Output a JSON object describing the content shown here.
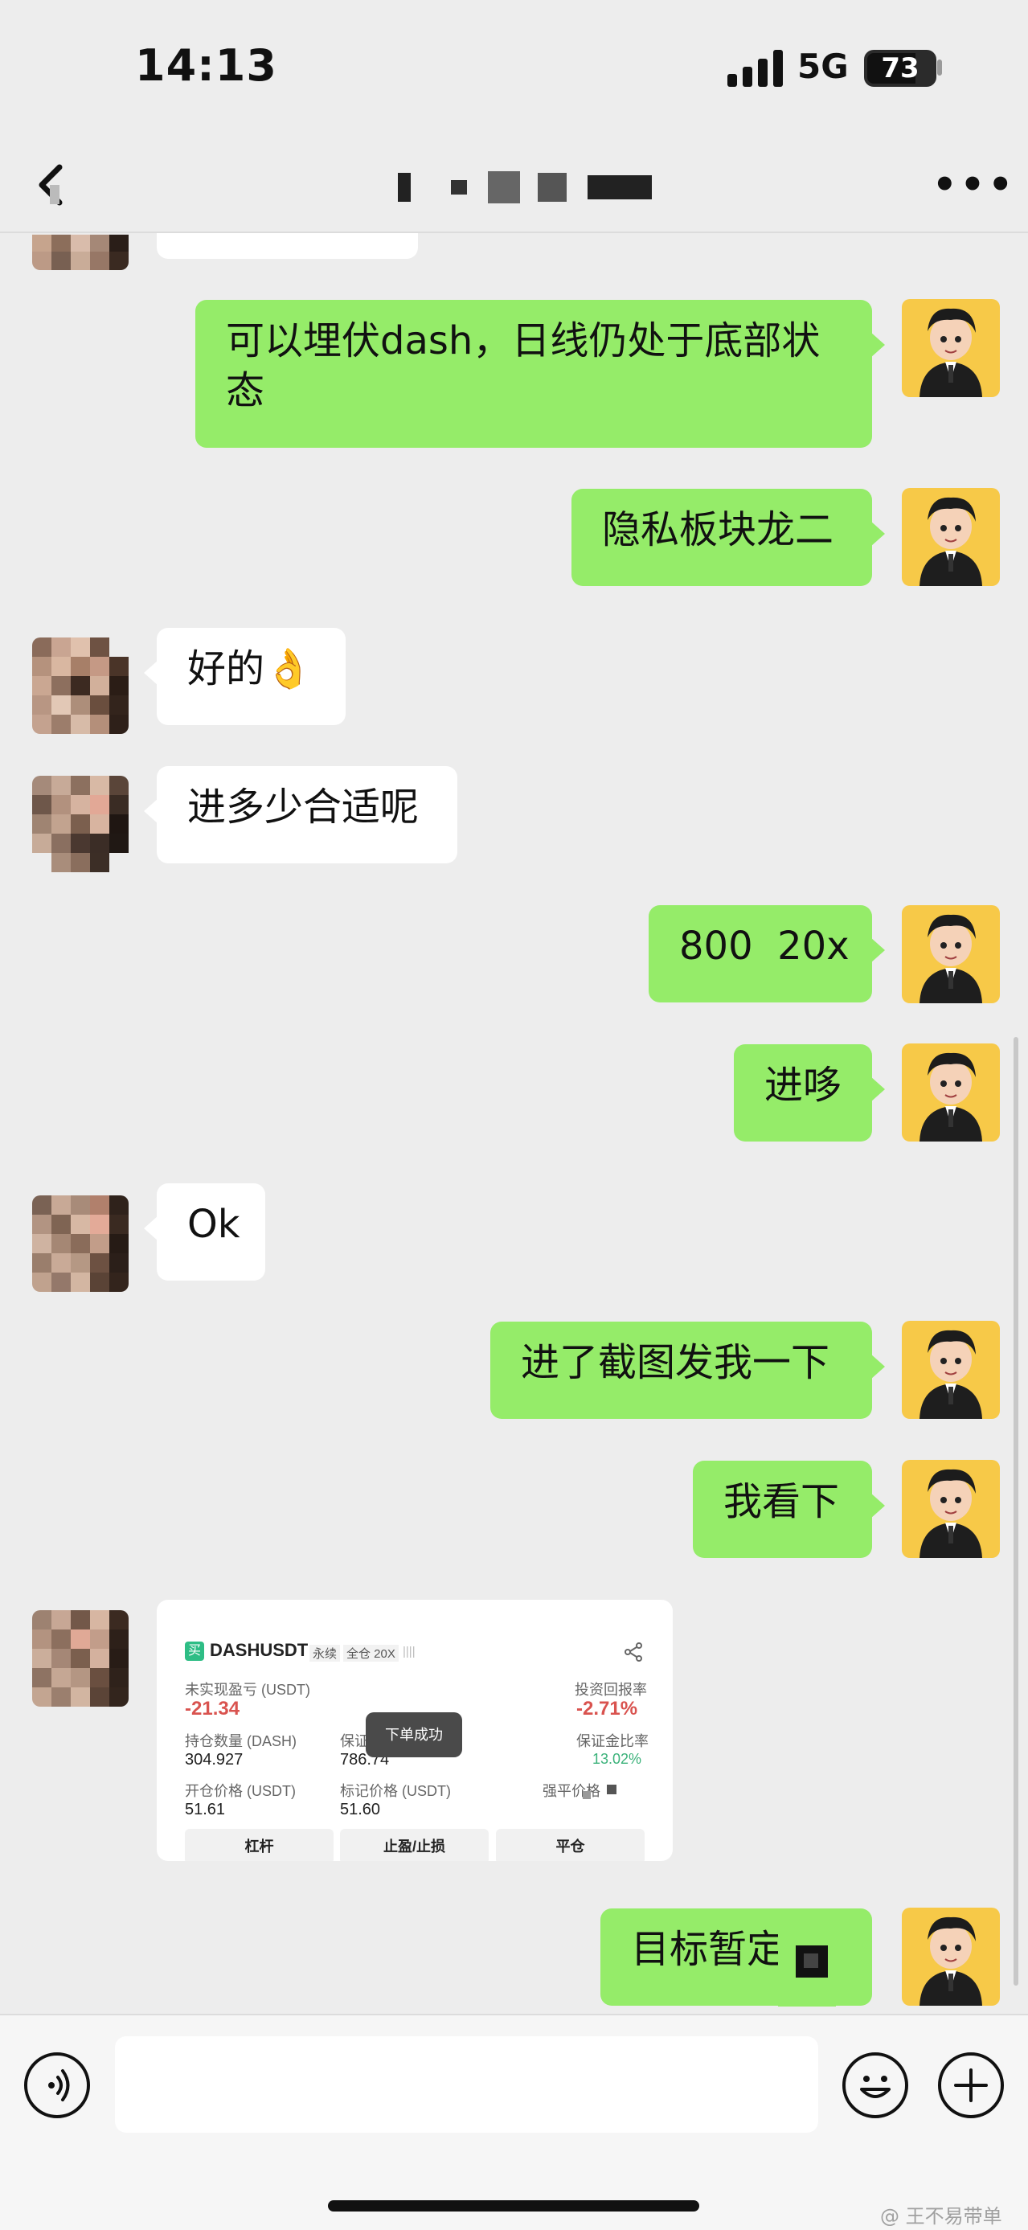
{
  "status_bar": {
    "time": "14:13",
    "network": "5G",
    "battery_level": "73",
    "battery_fraction": 0.73
  },
  "header": {
    "title": "",
    "more_label": "•••"
  },
  "messages": [
    {
      "side": "right",
      "text": "可以埋伏dash，日线仍处于底部状态"
    },
    {
      "side": "right",
      "text": "隐私板块龙二"
    },
    {
      "side": "left",
      "text": "好的👌"
    },
    {
      "side": "left",
      "text": "进多少合适呢"
    },
    {
      "side": "right",
      "text": "800  20x"
    },
    {
      "side": "right",
      "text": "进哆"
    },
    {
      "side": "left",
      "text": "Ok"
    },
    {
      "side": "right",
      "text": "进了截图发我一下"
    },
    {
      "side": "right",
      "text": "我看下"
    },
    {
      "side": "right",
      "text": "目标暂定"
    }
  ],
  "screenshot": {
    "badge": "买",
    "symbol": "DASHUSDT",
    "tag_perpetual": "永续",
    "tag_margin": "全仓 20X",
    "unrealized_pnl_label": "未实现盈亏 (USDT)",
    "unrealized_pnl_value": "-21.34",
    "roi_label": "投资回报率",
    "roi_value": "-2.71%",
    "position_label": "持仓数量 (DASH)",
    "position_value": "304.927",
    "margin_label": "保证",
    "margin_value": "786.74",
    "margin_ratio_label": "保证金比率",
    "margin_ratio_value": "13.02%",
    "entry_price_label": "开仓价格 (USDT)",
    "entry_price_value": "51.61",
    "mark_price_label": "标记价格 (USDT)",
    "mark_price_value": "51.60",
    "liq_price_label": "强平价格",
    "toast": "下单成功",
    "buttons": [
      "杠杆",
      "止盈/止损",
      "平仓"
    ]
  },
  "input_bar": {
    "placeholder": ""
  },
  "watermark": "@ 王不易带单",
  "colors": {
    "bubble_right": "#95ec69",
    "bubble_left": "#ffffff",
    "background": "#ededed",
    "avatar_bg": "#f7c948"
  },
  "icons": [
    "back-icon",
    "more-icon",
    "voice-icon",
    "emoji-icon",
    "plus-icon",
    "share-icon",
    "signal-icon"
  ]
}
